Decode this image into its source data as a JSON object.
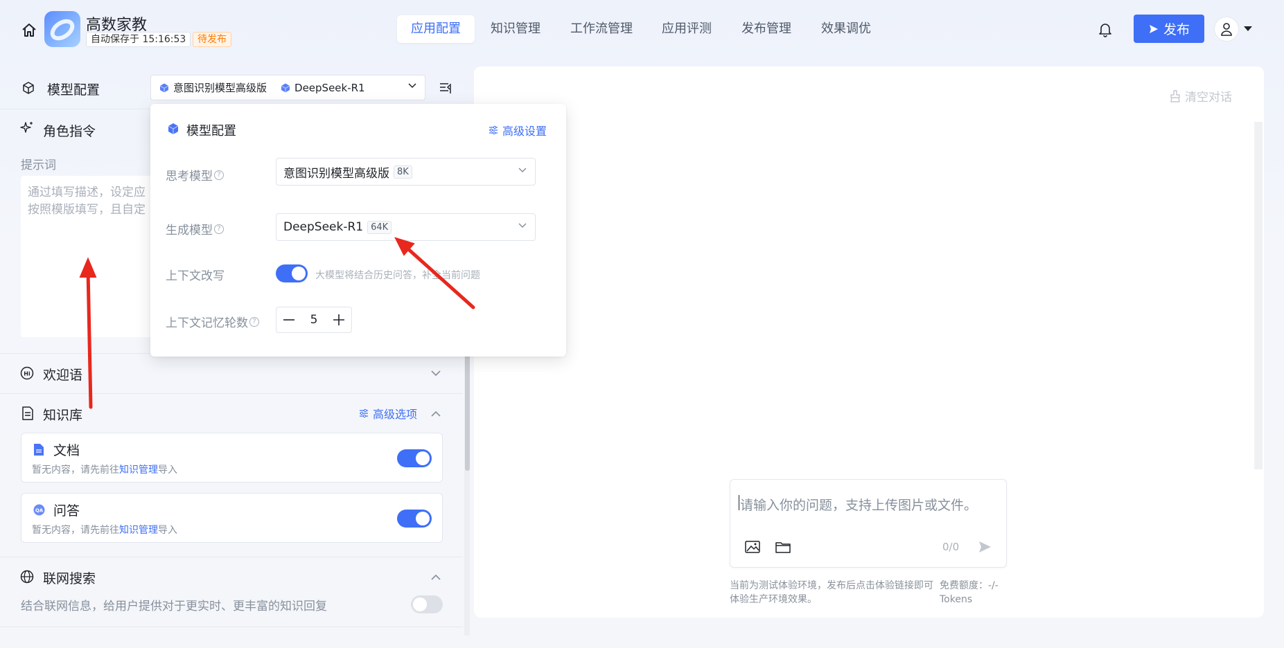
{
  "header": {
    "app_name": "高数家教",
    "autosave": "自动保存于 15:16:53",
    "status": "待发布",
    "tabs": [
      "应用配置",
      "知识管理",
      "工作流管理",
      "应用评测",
      "发布管理",
      "效果调优"
    ],
    "active_tab": "应用配置",
    "publish_label": "发布"
  },
  "model_config": {
    "title": "模型配置",
    "select_think": "意图识别模型高级版",
    "select_gen": "DeepSeek-R1"
  },
  "role": {
    "title": "角色指令",
    "prompt_label": "提示词",
    "prompt_line1": "通过填写描述，设定应",
    "prompt_line2": "按照模版填写，且自定"
  },
  "welcome": {
    "title": "欢迎语"
  },
  "knowledge": {
    "title": "知识库",
    "advanced_label": "高级选项",
    "items": [
      {
        "title": "文档",
        "desc_prefix": "暂无内容，请先前往",
        "link": "知识管理",
        "desc_suffix": "导入",
        "enabled": true
      },
      {
        "title": "问答",
        "desc_prefix": "暂无内容，请先前往",
        "link": "知识管理",
        "desc_suffix": "导入",
        "enabled": true
      }
    ]
  },
  "web_search": {
    "title": "联网搜索",
    "desc": "结合联网信息，给用户提供对于更实时、更丰富的知识回复",
    "enabled": false
  },
  "chat": {
    "clear_label": "清空对话",
    "input_placeholder": "请输入你的问题，支持上传图片或文件。",
    "char_count": "0/0",
    "env_note": "当前为测试体验环境，发布后点击体验链接即可体验生产环境效果。",
    "token_note": "免费额度：-/-Tokens"
  },
  "popover": {
    "title": "模型配置",
    "advanced_label": "高级设置",
    "think_label": "思考模型",
    "think_value": "意图识别模型高级版",
    "think_tag": "8K",
    "gen_label": "生成模型",
    "gen_value": "DeepSeek-R1",
    "gen_tag": "64K",
    "rewrite_label": "上下文改写",
    "rewrite_enabled": true,
    "rewrite_desc": "大模型将结合历史问答，补全当前问题",
    "memory_label": "上下文记忆轮数",
    "memory_value": "5"
  },
  "colors": {
    "accent": "#3e6ff6",
    "warning": "#ff7d00",
    "annotation_arrow": "#e8271d"
  }
}
